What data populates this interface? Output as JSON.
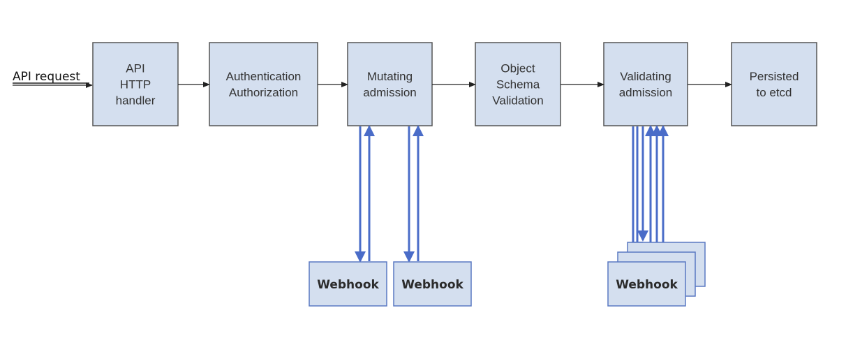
{
  "diagram": {
    "input_label": "API request",
    "stages": [
      {
        "id": "api-http-handler",
        "lines": [
          "API",
          "HTTP",
          "handler"
        ]
      },
      {
        "id": "authn-authz",
        "lines": [
          "Authentication",
          "Authorization"
        ]
      },
      {
        "id": "mutating-admission",
        "lines": [
          "Mutating",
          "admission"
        ]
      },
      {
        "id": "object-schema-validation",
        "lines": [
          "Object",
          "Schema",
          "Validation"
        ]
      },
      {
        "id": "validating-admission",
        "lines": [
          "Validating",
          "admission"
        ]
      },
      {
        "id": "persisted-to-etcd",
        "lines": [
          "Persisted",
          "to etcd"
        ]
      }
    ],
    "webhooks": [
      {
        "label": "Webhook",
        "attached_to": "mutating-admission",
        "stacked": false
      },
      {
        "label": "Webhook",
        "attached_to": "mutating-admission",
        "stacked": false
      },
      {
        "label": "Webhook",
        "attached_to": "validating-admission",
        "stacked": true
      }
    ],
    "colors": {
      "box_fill": "#d4dfef",
      "box_stroke": "#555555",
      "arrow_blue": "#4a6cc8"
    }
  }
}
